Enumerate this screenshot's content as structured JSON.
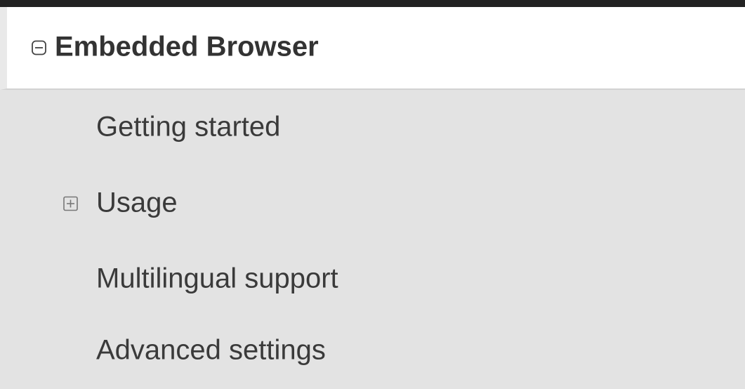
{
  "topbar": {},
  "section": {
    "title": "Embedded Browser",
    "icon": "collapse-minus-icon"
  },
  "tree": {
    "items": [
      {
        "label": "Getting started"
      },
      {
        "label": "Usage",
        "icon": "expand-plus-icon"
      },
      {
        "label": "Multilingual support"
      },
      {
        "label": "Advanced settings"
      }
    ]
  },
  "colors": {
    "header_bg": "#ffffff",
    "tree_bg": "#e3e3e3",
    "topbar": "#222222",
    "text": "#333333"
  }
}
